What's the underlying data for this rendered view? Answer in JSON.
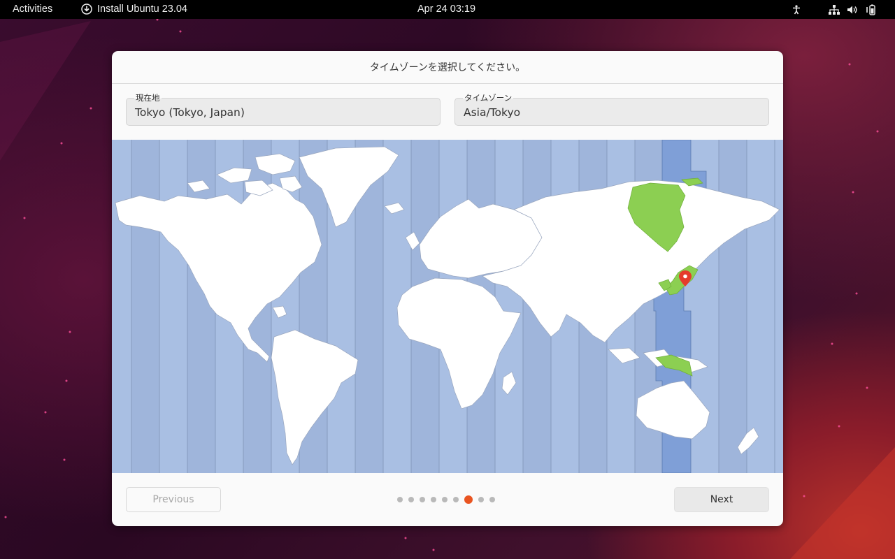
{
  "topbar": {
    "activities": "Activities",
    "app_title": "Install Ubuntu 23.04",
    "clock": "Apr 24  03:19",
    "tray_icons": [
      "accessibility-icon",
      "network-icon",
      "volume-icon",
      "battery-icon"
    ]
  },
  "dialog": {
    "title": "タイムゾーンを選択してください。",
    "location_field": {
      "label": "現在地",
      "value": "Tokyo (Tokyo, Japan)"
    },
    "timezone_field": {
      "label": "タイムゾーン",
      "value": "Asia/Tokyo"
    },
    "map": {
      "selected_zone": "Asia/Tokyo",
      "selected_city": "Tokyo",
      "highlight_color": "#8ccf52",
      "zone_highlight_color": "#7f9fd7",
      "ocean_color": "#a9bfe3"
    },
    "pager": {
      "total_steps": 9,
      "current_step": 7,
      "active_color": "#e95420"
    },
    "buttons": {
      "previous": "Previous",
      "next": "Next"
    }
  }
}
